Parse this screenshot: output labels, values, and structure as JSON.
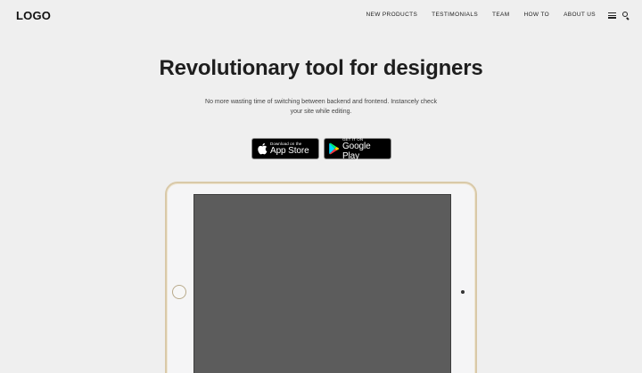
{
  "header": {
    "logo": "LOGO",
    "nav": [
      "NEW PRODUCTS",
      "TESTIMONIALS",
      "TEAM",
      "HOW TO",
      "ABOUT US"
    ]
  },
  "hero": {
    "title": "Revolutionary tool for designers",
    "subtitle": "No more wasting time of switching between backend and frontend. Instancely check your site while editing."
  },
  "badges": {
    "app_store": {
      "small": "Download on the",
      "big": "App Store"
    },
    "google_play": {
      "small": "GET IT ON",
      "big": "Google Play"
    }
  },
  "colors": {
    "background": "#efefef",
    "text": "#1e1e1e",
    "screen": "#5c5c5c",
    "tablet_frame": "#d9c9a8"
  }
}
